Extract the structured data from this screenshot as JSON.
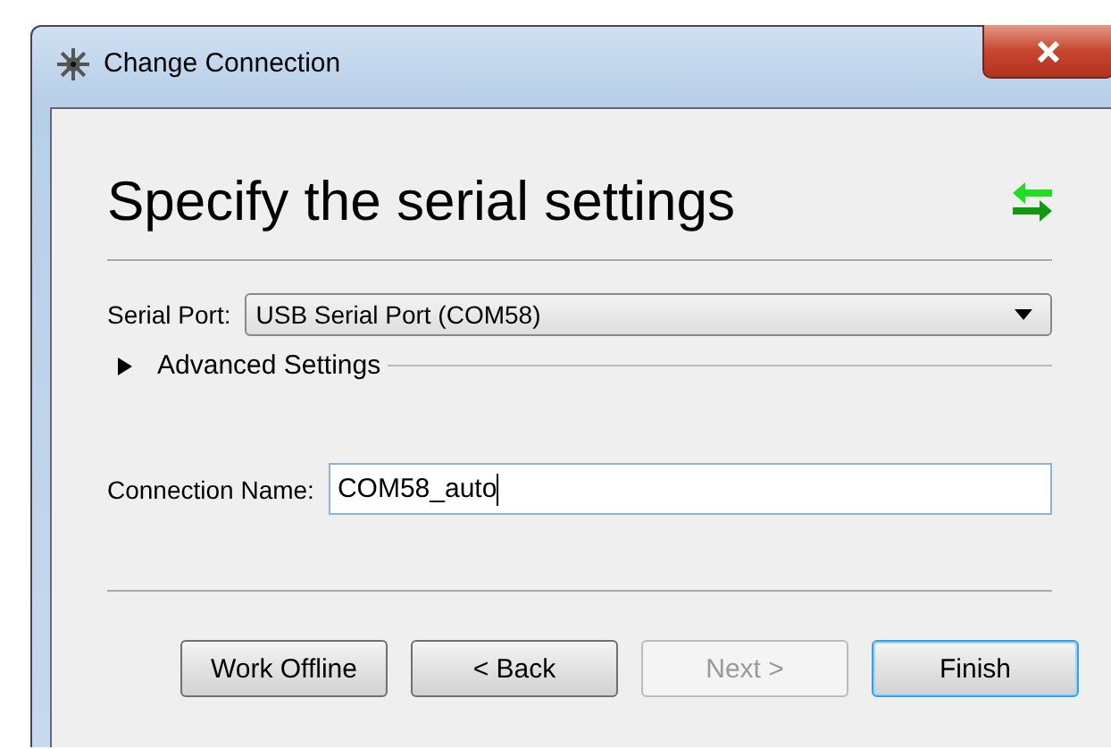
{
  "window": {
    "title": "Change Connection"
  },
  "heading": "Specify the serial settings",
  "serial_port": {
    "label": "Serial Port:",
    "value": "USB Serial Port (COM58)"
  },
  "advanced": {
    "label": "Advanced Settings",
    "expanded": false
  },
  "connection_name": {
    "label": "Connection Name:",
    "value": "COM58_auto"
  },
  "buttons": [
    {
      "label": "Work Offline",
      "disabled": false,
      "default": false
    },
    {
      "label": "< Back",
      "disabled": false,
      "default": false
    },
    {
      "label": "Next >",
      "disabled": true,
      "default": false
    },
    {
      "label": "Finish",
      "disabled": false,
      "default": true
    }
  ]
}
